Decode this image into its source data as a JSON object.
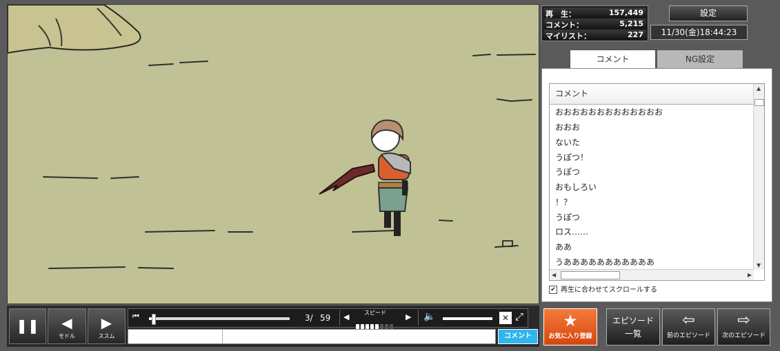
{
  "stats": {
    "play_label": "再　生：",
    "play_value": "157,449",
    "comment_label": "コメント：",
    "comment_value": "5,215",
    "mylist_label": "マイリスト：",
    "mylist_value": "227"
  },
  "settings_label": "設定",
  "datetime": "11/30(金)18:44:23",
  "tabs": {
    "comment": "コメント",
    "ng": "NG設定"
  },
  "comment_list": {
    "header": "コメント",
    "items": [
      "おおおおおおおおおおおおお",
      "おおお",
      "ないた",
      "うぽつ！",
      "うぽつ",
      "おもしろい",
      "！？",
      "うぽつ",
      "ロス……",
      "ああ",
      "うあああああああああああ"
    ]
  },
  "autoscroll_label": "再生に合わせてスクロールする",
  "controls": {
    "back_label": "モドル",
    "forward_label": "ススム",
    "time_current": "3/",
    "time_total": "59",
    "speed_label": "スピード",
    "comment_submit": "コメント",
    "seek_progress": 0.02,
    "volume_level": 1.0
  },
  "favorite_label": "お気に入り登録",
  "episode_list_label_1": "エピソード",
  "episode_list_label_2": "一覧",
  "prev_episode_label": "前のエピソード",
  "next_episode_label": "次のエピソード"
}
